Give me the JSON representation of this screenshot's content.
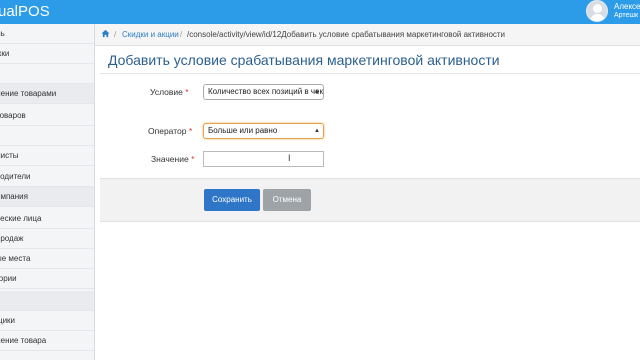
{
  "header": {
    "brand": "ualPOS",
    "user_name": "Алексе",
    "user_sub": "Артешк"
  },
  "sidebar": {
    "items": [
      {
        "label": "ль",
        "section": false
      },
      {
        "label": "жки",
        "section": false
      },
      {
        "label": "г",
        "section": false
      },
      {
        "label": "ление товарами",
        "section": true
      },
      {
        "label": " товаров",
        "section": false
      },
      {
        "label": "з",
        "section": false
      },
      {
        "label": "листы",
        "section": false
      },
      {
        "label": "водители",
        "section": false
      },
      {
        "label": "омпания",
        "section": true
      },
      {
        "label": "ческие лица",
        "section": false
      },
      {
        "label": " продаж",
        "section": false
      },
      {
        "label": "ые места",
        "section": false
      },
      {
        "label": "гории",
        "section": false
      },
      {
        "label": "",
        "section": true
      },
      {
        "label": "щики",
        "section": false
      },
      {
        "label": "ление товара",
        "section": false
      }
    ]
  },
  "breadcrumb": {
    "home_icon": "home-icon",
    "sep": "/",
    "link": "Скидки и акции",
    "current": "/console/activity/view/id/12Добавить условие срабатывания маркетинговой активности"
  },
  "page": {
    "title": "Добавить условие срабатывания маркетинговой активности"
  },
  "form": {
    "condition_label": "Условие",
    "condition_value": "Количество всех позиций в чеке",
    "operator_label": "Оператор",
    "operator_value": "Больше или равно",
    "value_label": "Значение",
    "value_value": "",
    "required_mark": "*"
  },
  "actions": {
    "save": "Сохранить",
    "cancel": "Отмена"
  },
  "colors": {
    "topbar": "#2d9ce8",
    "save": "#2f76c8",
    "cancel": "#9ea3a8",
    "title": "#2b5f8f"
  }
}
